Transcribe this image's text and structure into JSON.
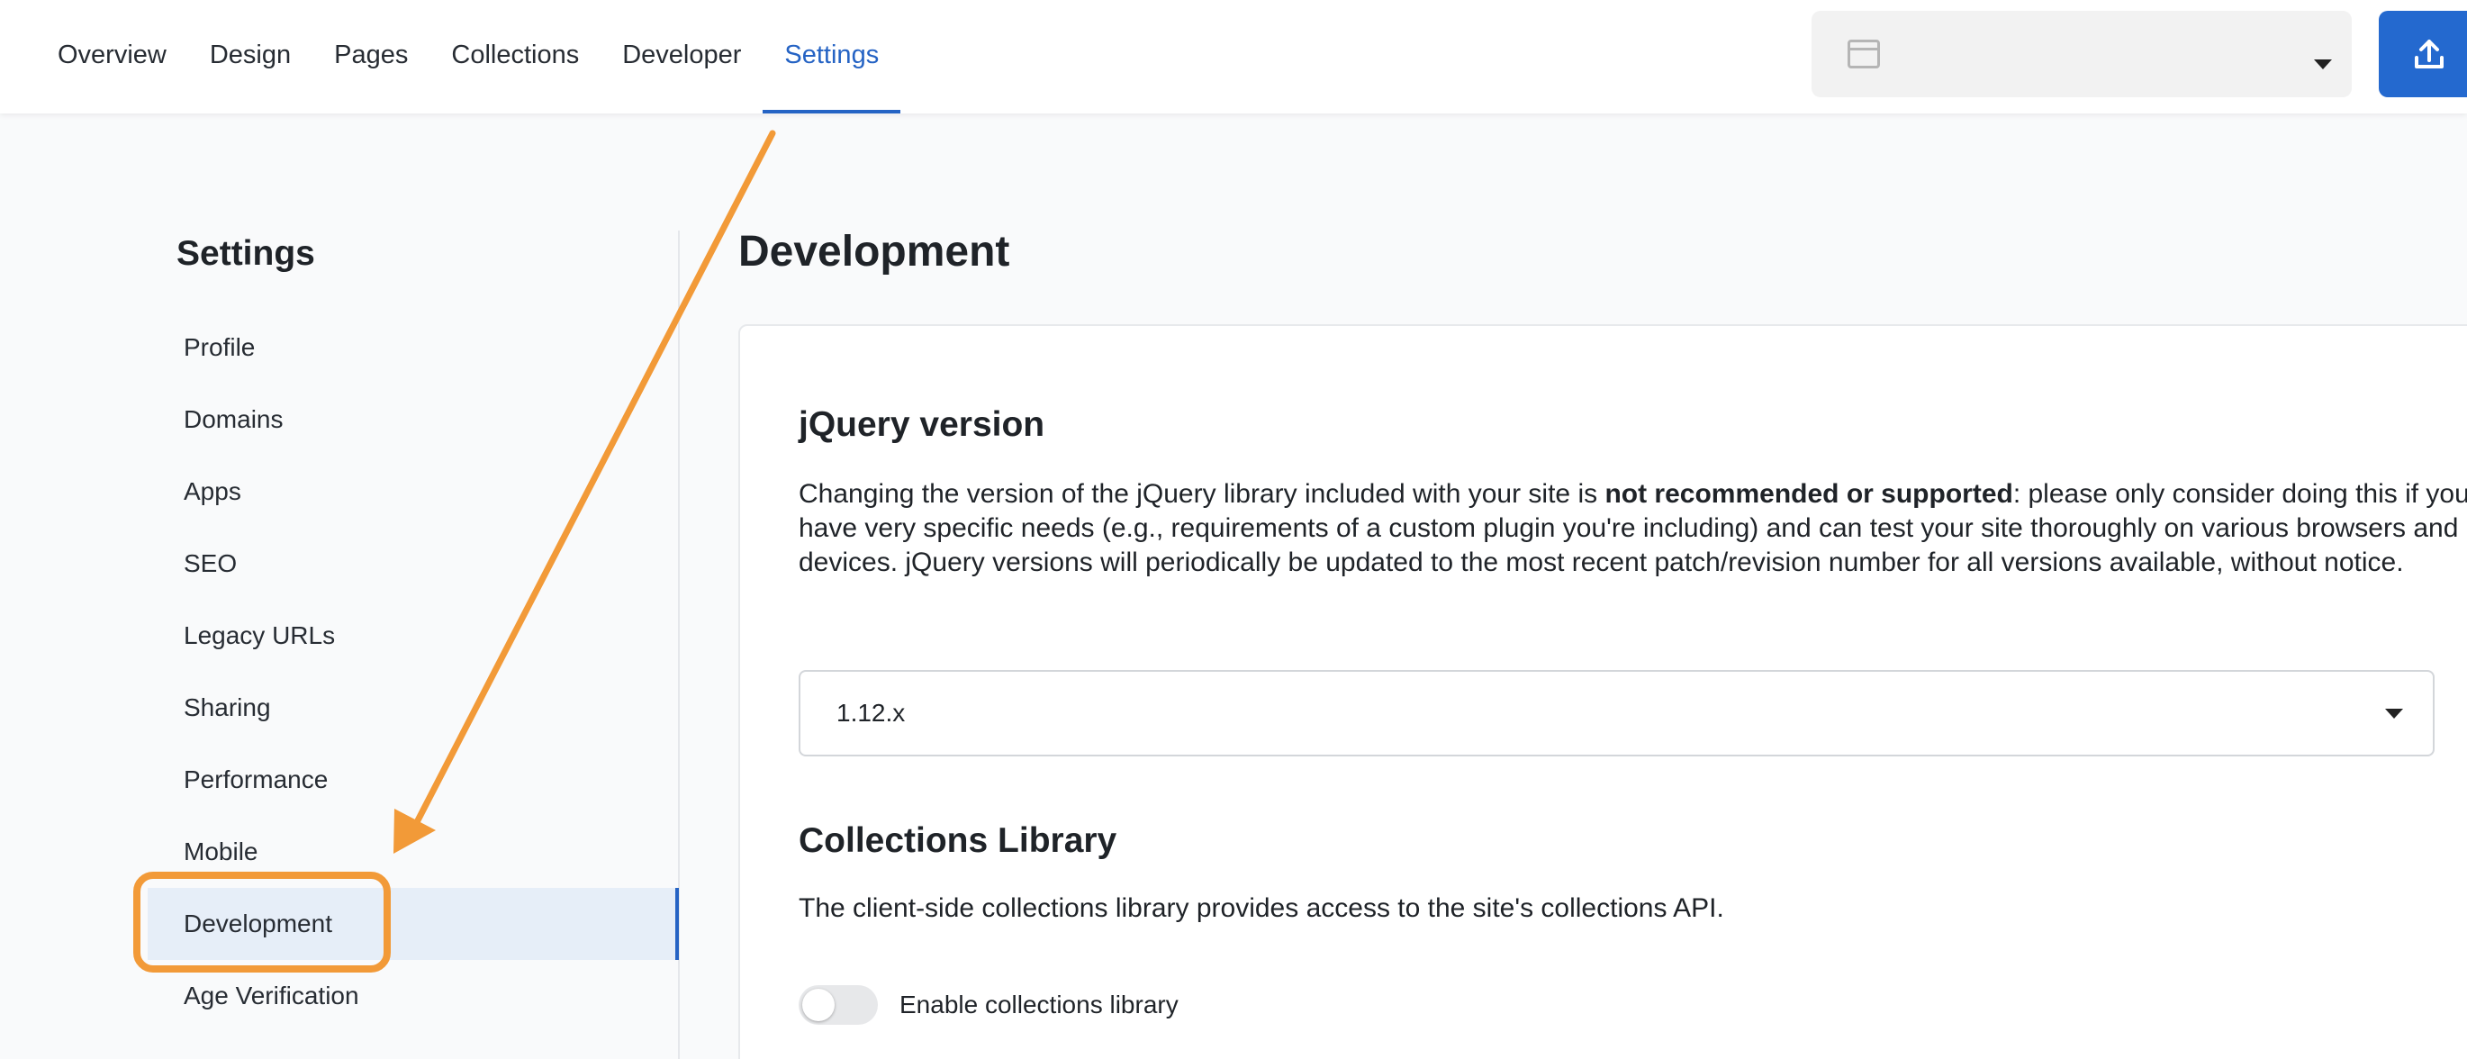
{
  "nav": {
    "tabs": [
      {
        "label": "Overview"
      },
      {
        "label": "Design"
      },
      {
        "label": "Pages"
      },
      {
        "label": "Collections"
      },
      {
        "label": "Developer"
      },
      {
        "label": "Settings",
        "active": true
      }
    ]
  },
  "header": {
    "site_select_icon": "browser-window-icon",
    "publish_icon": "upload-icon"
  },
  "sidebar": {
    "title": "Settings",
    "items": [
      {
        "label": "Profile"
      },
      {
        "label": "Domains"
      },
      {
        "label": "Apps"
      },
      {
        "label": "SEO"
      },
      {
        "label": "Legacy URLs"
      },
      {
        "label": "Sharing"
      },
      {
        "label": "Performance"
      },
      {
        "label": "Mobile"
      },
      {
        "label": "Development",
        "active": true
      },
      {
        "label": "Age Verification"
      }
    ]
  },
  "main": {
    "title": "Development",
    "jquery": {
      "title": "jQuery version",
      "desc_pre": "Changing the version of the jQuery library included with your site is ",
      "desc_bold": "not recommended or supported",
      "desc_post": ": please only consider doing this if you have very specific needs (e.g., requirements of a custom plugin you're including) and can test your site thoroughly on various browsers and devices. jQuery versions will periodically be updated to the most recent patch/revision number for all versions available, without notice.",
      "selected": "1.12.x"
    },
    "collections": {
      "title": "Collections Library",
      "desc": "The client-side collections library provides access to the site's collections API.",
      "toggle_label": "Enable collections library",
      "toggle_on": false
    }
  },
  "colors": {
    "accent": "#2563c4",
    "publish": "#2469cf",
    "annotation": "#f29a38",
    "active_item_bg": "#e6eef8"
  }
}
